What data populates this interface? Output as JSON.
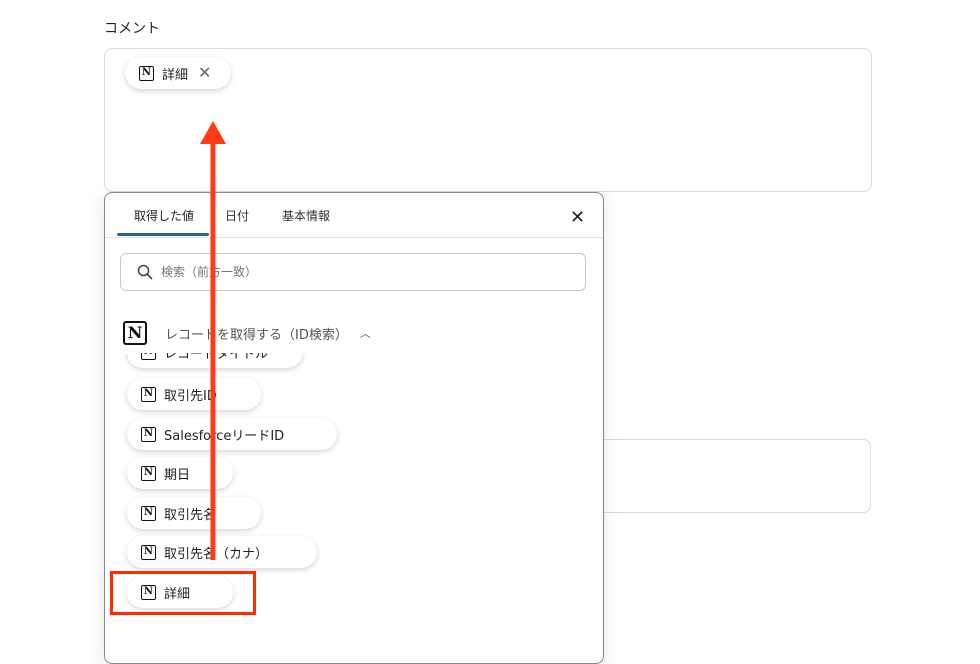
{
  "field_label": "コメント",
  "comment": {
    "token": {
      "icon": "notion-icon",
      "label": "詳細",
      "remove_icon": "close-icon"
    }
  },
  "panel": {
    "tabs": [
      {
        "label": "取得した値",
        "active": true
      },
      {
        "label": "日付",
        "active": false
      },
      {
        "label": "基本情報",
        "active": false
      }
    ],
    "close_icon": "close-icon",
    "search": {
      "icon": "search-icon",
      "placeholder": "検索（前方一致）"
    },
    "section": {
      "icon": "notion-icon",
      "title": "レコードを取得する（ID検索）",
      "chevron": "chevron-up-icon"
    },
    "items": [
      {
        "label": "レコードタイトル"
      },
      {
        "label": "取引先ID"
      },
      {
        "label": "SalesforceリードID"
      },
      {
        "label": "期日"
      },
      {
        "label": "取引先名"
      },
      {
        "label": "取引先名（カナ）"
      },
      {
        "label": "詳細"
      }
    ]
  },
  "colors": {
    "arrow": "#ff3b14",
    "highlight": "#ff2a00",
    "tab_underline": "#1f6b86"
  }
}
